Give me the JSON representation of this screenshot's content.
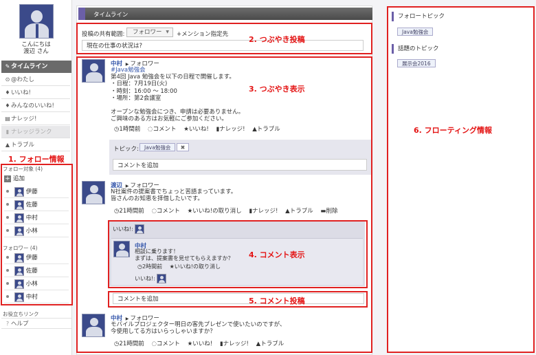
{
  "sidebar": {
    "greeting": "こんにちは",
    "user_name": "渡辺 さん",
    "nav": {
      "timeline": "タイムライン",
      "mentions": "@わたし",
      "likes": "いいね!",
      "everyone_likes": "みんなのいいね!",
      "knowledge": "ナレッジ!",
      "knowledge_rank": "ナレッジランク",
      "trouble": "トラブル"
    },
    "following_header": "フォロー対象 (4)",
    "add_label": "追加",
    "following": [
      "伊藤",
      "佐藤",
      "中村",
      "小林"
    ],
    "followers_header": "フォロワー (4)",
    "followers": [
      "伊藤",
      "佐藤",
      "小林",
      "中村"
    ],
    "links_header": "お役立ちリンク",
    "help": "ヘルプ"
  },
  "main": {
    "header_title": "タイムライン",
    "compose": {
      "scope_label": "投稿の共有範囲:",
      "scope_value": "フォロワー",
      "mention_label": "+メンション指定先",
      "input_value": "現在の仕事の状況は?"
    },
    "posts": [
      {
        "author": "中村",
        "target": "フォロワー",
        "lines": [
          "#Java勉強会",
          "第4回 Java 勉強会を以下の日程で開催します。",
          "・日程：7月19日(火)",
          "・時刻：16:00 ～ 18:00",
          "・場所：第2会議室",
          "",
          "オープンな勉強会につき、申請は必要ありません。",
          "ご興味のある方はお気軽にご参加ください。"
        ],
        "actions": [
          "1時間前",
          "コメント",
          "いいね!",
          "ナレッジ!",
          "トラブル"
        ],
        "topic_label": "トピック:",
        "topic_tag": "Java勉強会",
        "comment_placeholder": "コメントを追加"
      },
      {
        "author": "渡辺",
        "target": "フォロワー",
        "lines": [
          "N社案件の提案書でちょっと苦語まっています。",
          "皆さんのお知恵を拝借したいです。"
        ],
        "actions": [
          "21時間前",
          "コメント",
          "いいね!の取り消し",
          "ナレッジ!",
          "トラブル",
          "削除"
        ],
        "likes_label": "いいね!:",
        "comment": {
          "author": "中村",
          "lines": [
            "相談に乗ります！",
            "まずは、提案書を見せてもらえますか？"
          ],
          "time": "2時間前",
          "like_cancel": "いいね!の取り消し",
          "likes_label": "いいね!:"
        },
        "comment_placeholder": "コメントを追加"
      },
      {
        "author": "中村",
        "target": "フォロワー",
        "lines": [
          "モバイルプロジェクター明日の客先プレゼンで使いたいのですが、",
          "今使用してる方はいらっしゃいますか？"
        ],
        "actions": [
          "21時間前",
          "コメント",
          "いいね!",
          "ナレッジ!",
          "トラブル"
        ]
      }
    ]
  },
  "right": {
    "follow_topic_header": "フォロートピック",
    "follow_topic_tag": "Java勉強会",
    "trending_header": "話題のトピック",
    "trending_tag": "展示会2016"
  },
  "annotations": {
    "follow_info": "1. フォロー情報",
    "post_compose": "2. つぶやき投稿",
    "post_display": "3. つぶやき表示",
    "comment_display": "4. コメント表示",
    "comment_post": "5. コメント投稿",
    "floating_info": "6. フローティング情報"
  },
  "colors": {
    "annotation_red": "#e02020",
    "header_dark": "#5a5a5a",
    "accent_purple": "#6b5fa8",
    "link_blue": "#3355aa"
  }
}
